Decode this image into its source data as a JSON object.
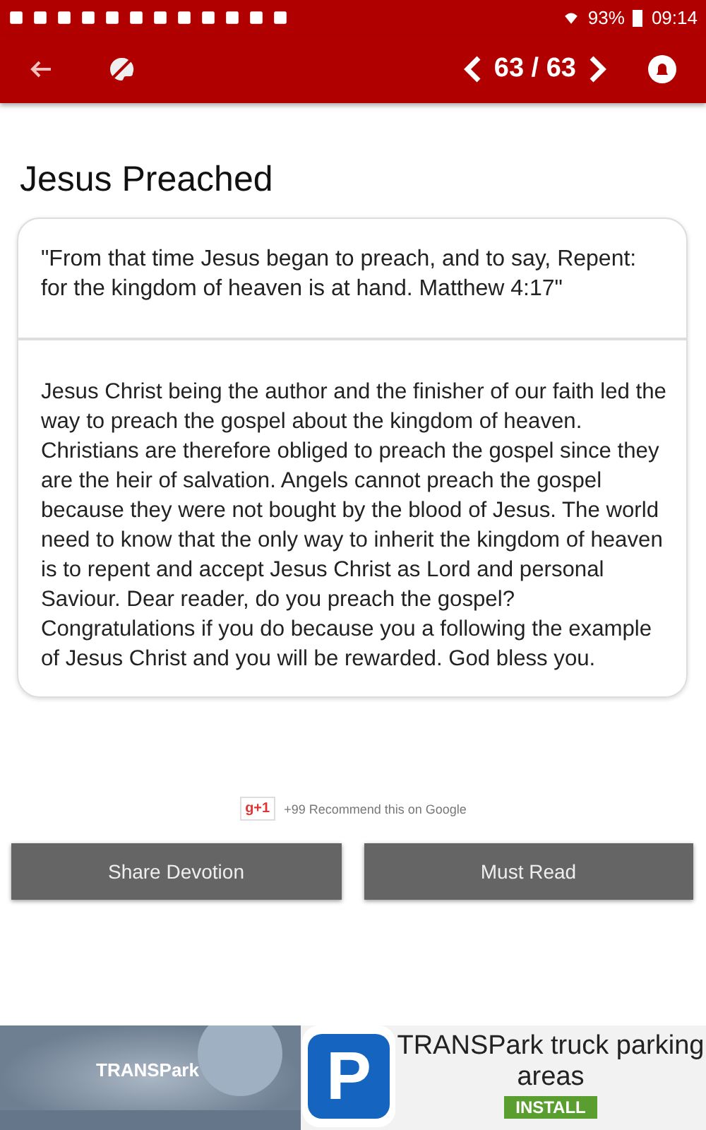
{
  "status_bar": {
    "battery": "93%",
    "time": "09:14"
  },
  "toolbar": {
    "counter": "63 / 63"
  },
  "title": "Jesus Preached",
  "card": {
    "quote": "\"From that time Jesus began to preach, and to say, Repent: for the kingdom of heaven is at hand. Matthew 4:17\"",
    "body": "Jesus Christ being the author and the finisher of our faith led the way to preach the gospel about the kingdom of heaven. Christians are therefore obliged to preach the gospel since they are the heir of salvation. Angels cannot preach the gospel because they were not bought by the blood of Jesus. The world need to know that the only way to inherit the kingdom of heaven is to repent and accept Jesus Christ as Lord and personal Saviour. Dear reader, do you preach the gospel? Congratulations if you do because you a following the example of Jesus Christ and you will be rewarded. God bless you."
  },
  "plus_one": {
    "button": "g+1",
    "caption": "+99 Recommend this on Google"
  },
  "buttons": [
    "Share Devotion",
    "Must Read"
  ],
  "ad": {
    "kind": "picture",
    "banner_text": "TRANSPark",
    "icon_letter": "P",
    "headline": "TRANSPark truck parking areas",
    "install": "INSTALL"
  }
}
